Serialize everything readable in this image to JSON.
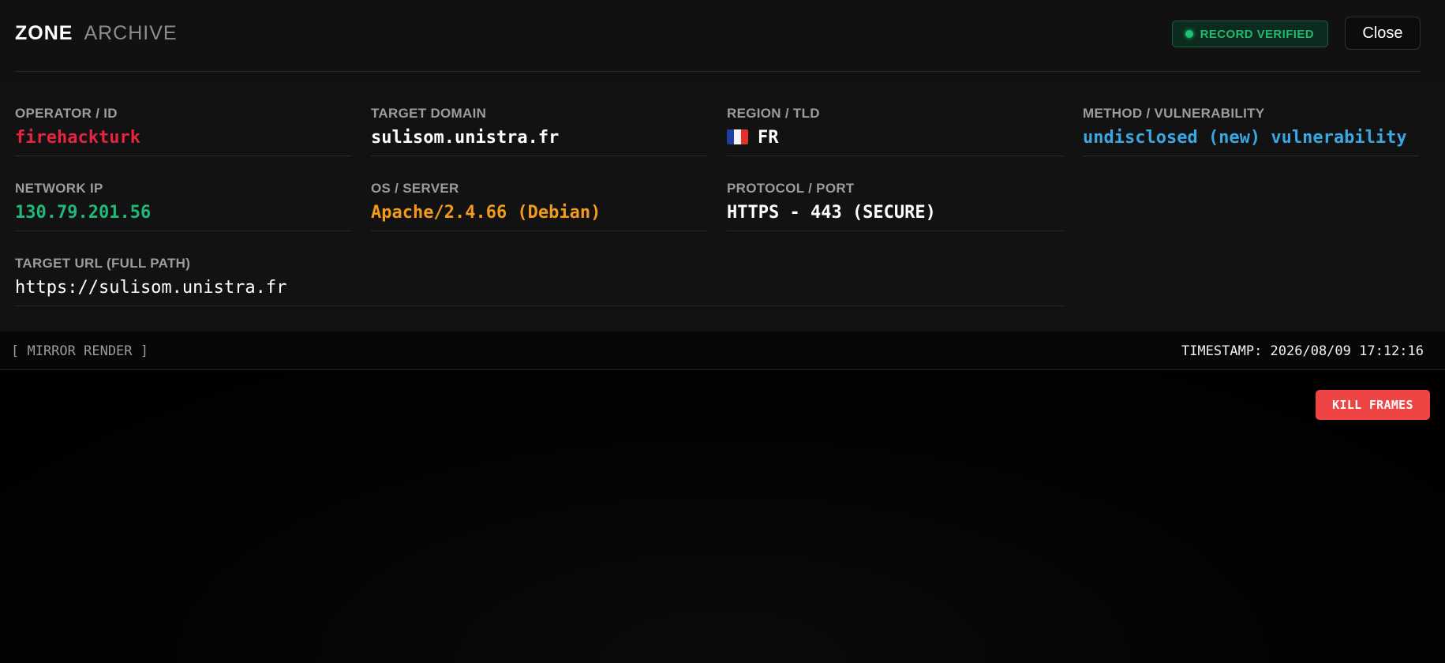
{
  "header": {
    "brand_primary": "ZONE",
    "brand_secondary": "ARCHIVE",
    "status_badge": "RECORD VERIFIED",
    "close_label": "Close"
  },
  "fields": {
    "operator": {
      "label": "OPERATOR / ID",
      "value": "firehackturk"
    },
    "target_domain": {
      "label": "TARGET DOMAIN",
      "value": "sulisom.unistra.fr"
    },
    "region": {
      "label": "REGION / TLD",
      "value": "FR",
      "flag_icon": "france-flag-icon"
    },
    "method": {
      "label": "METHOD / VULNERABILITY",
      "value": "undisclosed (new) vulnerability"
    },
    "network_ip": {
      "label": "NETWORK IP",
      "value": "130.79.201.56"
    },
    "os_server": {
      "label": "OS / SERVER",
      "value": "Apache/2.4.66 (Debian)"
    },
    "protocol": {
      "label": "PROTOCOL / PORT",
      "value": "HTTPS - 443 (SECURE)"
    },
    "target_url": {
      "label": "TARGET URL (FULL PATH)",
      "value": "https://sulisom.unistra.fr"
    }
  },
  "render_bar": {
    "label": "[ MIRROR RENDER ]",
    "timestamp": "TIMESTAMP: 2026/08/09 17:12:16"
  },
  "mirror": {
    "kill_label": "KILL FRAMES"
  },
  "colors": {
    "operator": "#e5253f",
    "method": "#3aa7e2",
    "network_ip": "#1fb978",
    "os_server": "#f29a1b",
    "verified": "#22b872",
    "kill_button": "#ef4444"
  }
}
